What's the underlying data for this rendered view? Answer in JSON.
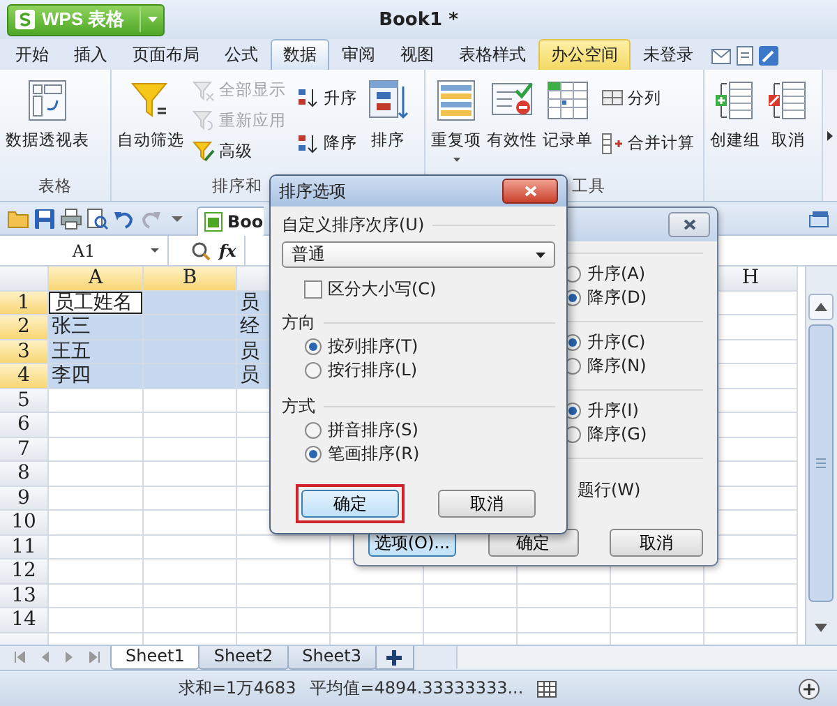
{
  "app_button": {
    "label": "WPS 表格"
  },
  "window": {
    "title": "Book1 *"
  },
  "menu_tabs": [
    {
      "label": "开始",
      "selected": false,
      "kind": "plain"
    },
    {
      "label": "插入",
      "selected": false,
      "kind": "plain"
    },
    {
      "label": "页面布局",
      "selected": false,
      "kind": "plain"
    },
    {
      "label": "公式",
      "selected": false,
      "kind": "plain"
    },
    {
      "label": "数据",
      "selected": true,
      "kind": "plain"
    },
    {
      "label": "审阅",
      "selected": false,
      "kind": "plain"
    },
    {
      "label": "视图",
      "selected": false,
      "kind": "plain"
    },
    {
      "label": "表格样式",
      "selected": false,
      "kind": "plain"
    },
    {
      "label": "办公空间",
      "selected": false,
      "kind": "highlight"
    },
    {
      "label": "未登录",
      "selected": false,
      "kind": "plain"
    }
  ],
  "ribbon_groups": [
    {
      "label": "表格",
      "items": [
        {
          "label": "数据透视表",
          "kind": "large",
          "disabled": false
        }
      ]
    },
    {
      "label": "排序和",
      "items": [
        {
          "label": "自动筛选",
          "kind": "large",
          "disabled": false
        },
        {
          "label": "全部显示",
          "kind": "small",
          "disabled": true
        },
        {
          "label": "重新应用",
          "kind": "small",
          "disabled": true
        },
        {
          "label": "高级",
          "kind": "small",
          "disabled": false
        },
        {
          "label": "升序",
          "kind": "small",
          "disabled": false
        },
        {
          "label": "降序",
          "kind": "small",
          "disabled": false
        },
        {
          "label": "排序",
          "kind": "large",
          "disabled": false
        }
      ]
    },
    {
      "label": "工具",
      "items": [
        {
          "label": "重复项",
          "kind": "large",
          "disabled": false,
          "menu": true
        },
        {
          "label": "有效性",
          "kind": "large",
          "disabled": false
        },
        {
          "label": "记录单",
          "kind": "large",
          "disabled": false
        },
        {
          "label": "分列",
          "kind": "small",
          "disabled": false
        },
        {
          "label": "合并计算",
          "kind": "small",
          "disabled": false
        }
      ]
    },
    {
      "items": [
        {
          "label": "创建组",
          "kind": "large",
          "disabled": false
        },
        {
          "label": "取消",
          "kind": "large",
          "disabled": false
        }
      ]
    }
  ],
  "doc_tab": {
    "label": "Boo"
  },
  "name_box": {
    "value": "A1"
  },
  "formula_bar": {
    "fx": "fx"
  },
  "sheet": {
    "column_headers": [
      {
        "label": "A",
        "selected": true
      },
      {
        "label": "B",
        "selected": true
      },
      {
        "label": "H",
        "selected": false
      }
    ],
    "rows": [
      {
        "number": "1",
        "selected": true,
        "cells": [
          {
            "text": "员工姓名",
            "active": true
          },
          {
            "active": false
          },
          {
            "text": "员",
            "active": false
          }
        ]
      },
      {
        "number": "2",
        "selected": true,
        "cells": [
          {
            "text": "张三",
            "active": false
          },
          {
            "active": false
          },
          {
            "text": "经",
            "active": false
          }
        ]
      },
      {
        "number": "3",
        "selected": true,
        "cells": [
          {
            "text": "王五",
            "active": false
          },
          {
            "active": false
          },
          {
            "text": "员",
            "active": false
          }
        ]
      },
      {
        "number": "4",
        "selected": true,
        "cells": [
          {
            "text": "李四",
            "active": false
          },
          {
            "active": false
          },
          {
            "text": "员",
            "active": false
          }
        ]
      },
      {
        "number": "5",
        "selected": false
      },
      {
        "number": "6",
        "selected": false
      },
      {
        "number": "7",
        "selected": false
      },
      {
        "number": "8",
        "selected": false
      },
      {
        "number": "9",
        "selected": false
      },
      {
        "number": "10",
        "selected": false
      },
      {
        "number": "11",
        "selected": false
      },
      {
        "number": "12",
        "selected": false
      },
      {
        "number": "13",
        "selected": false
      },
      {
        "number": "14",
        "selected": false
      }
    ]
  },
  "sheet_tabs": [
    {
      "label": "Sheet1",
      "selected": true
    },
    {
      "label": "Sheet2",
      "selected": false
    },
    {
      "label": "Sheet3",
      "selected": false
    }
  ],
  "status_bar": {
    "sum": "求和=1万4683",
    "average": "平均值=4894.33333333..."
  },
  "sort_dialog": {
    "options": [
      {
        "label": "升序(A)",
        "selected": false
      },
      {
        "label": "降序(D)",
        "selected": true
      },
      {
        "label": "升序(C)",
        "selected": true
      },
      {
        "label": "降序(N)",
        "selected": false
      },
      {
        "label": "升序(I)",
        "selected": true
      },
      {
        "label": "降序(G)",
        "selected": false
      }
    ],
    "header_row_label": "题行(W)",
    "buttons": [
      {
        "label": "选项(O)...",
        "focused": true
      },
      {
        "label": "确定",
        "focused": false
      },
      {
        "label": "取消",
        "focused": false
      }
    ]
  },
  "sort_options_dialog": {
    "title": "排序选项",
    "custom_order_label": "自定义排序次序(U)",
    "custom_order": "普通",
    "case_sensitive": {
      "label": "区分大小写(C)",
      "checked": false
    },
    "direction": {
      "label": "方向",
      "options": [
        {
          "label": "按列排序(T)",
          "selected": true
        },
        {
          "label": "按行排序(L)",
          "selected": false
        }
      ]
    },
    "method": {
      "label": "方式",
      "options": [
        {
          "label": "拼音排序(S)",
          "selected": false
        },
        {
          "label": "笔画排序(R)",
          "selected": true
        }
      ]
    },
    "buttons": [
      {
        "label": "确定",
        "highlighted": true
      },
      {
        "label": "取消",
        "highlighted": false
      }
    ]
  }
}
